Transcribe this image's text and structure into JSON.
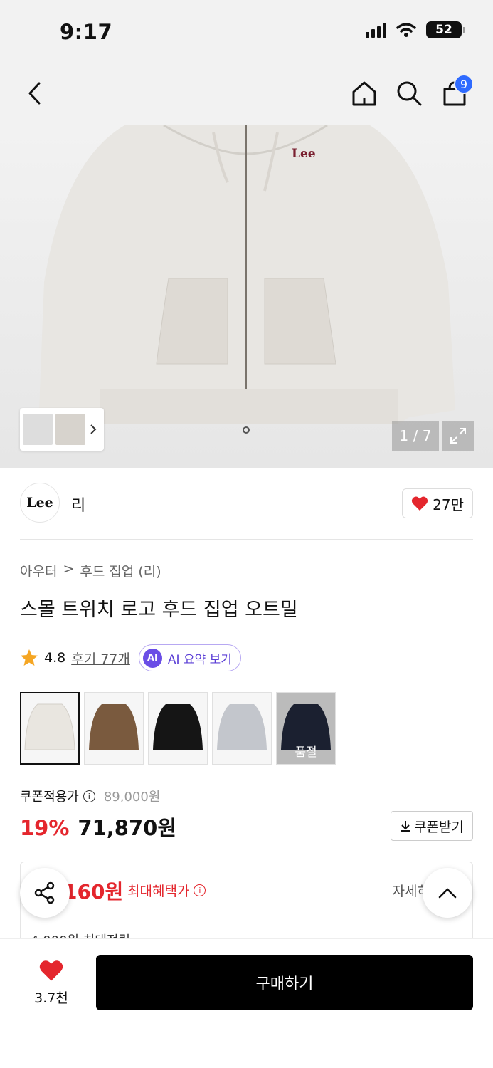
{
  "status": {
    "time": "9:17",
    "battery": "52"
  },
  "header": {
    "cart_count": "9"
  },
  "gallery": {
    "counter": "1 / 7"
  },
  "brand": {
    "logo_text": "Lee",
    "name": "리",
    "like_count": "27만"
  },
  "breadcrumb": {
    "category": "아우터",
    "separator": ">",
    "subcategory": "후드 집업 (리)"
  },
  "product": {
    "title": "스몰 트위치 로고 후드 집업 오트밀"
  },
  "rating": {
    "score": "4.8",
    "reviews_label": "후기 77개",
    "ai_badge": "AI",
    "ai_summary_label": "AI 요약 보기"
  },
  "colors": [
    {
      "name": "oatmeal",
      "hex": "#e9e6e0",
      "sold_out": false
    },
    {
      "name": "brown",
      "hex": "#7a5a3e",
      "sold_out": false
    },
    {
      "name": "black",
      "hex": "#151515",
      "sold_out": false
    },
    {
      "name": "gray",
      "hex": "#c3c6cc",
      "sold_out": false
    },
    {
      "name": "navy",
      "hex": "#1b2030",
      "sold_out": true
    }
  ],
  "soldout_label": "품절",
  "pricing": {
    "coupon_price_label": "쿠폰적용가",
    "original_price": "89,000원",
    "discount": "19%",
    "price": "71,870원",
    "coupon_button": "쿠폰받기"
  },
  "benefit": {
    "price": "160원",
    "label": "최대혜택가",
    "detail": "자세히",
    "sub": "4,000원 최대적립"
  },
  "bottom": {
    "wish_count": "3.7천",
    "buy_label": "구매하기"
  },
  "colors_theme": {
    "accent_red": "#e4262d",
    "ai_purple": "#6a4de6",
    "badge_blue": "#2f6bff"
  }
}
